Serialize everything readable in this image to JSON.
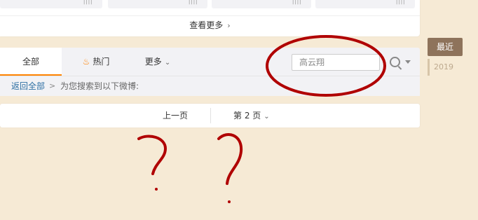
{
  "feed": {
    "see_more_label": "查看更多",
    "stub_glyph": "|",
    "stub_value": "||||"
  },
  "tabs": {
    "all_label": "全部",
    "hot_label": "热门",
    "more_label": "更多"
  },
  "search": {
    "placeholder": "高云翔",
    "value": ""
  },
  "breadcrumb": {
    "back_label": "返回全部",
    "separator": ">",
    "text": "为您搜索到以下微博:"
  },
  "pager": {
    "prev_label": "上一页",
    "page_label": "第 2 页"
  },
  "timeline": {
    "recent_label": "最近",
    "year_label": "2019"
  },
  "icons": {
    "flame": "flame-icon",
    "search": "search-icon",
    "chevron": "chevron-icon"
  },
  "colors": {
    "background": "#f6ead5",
    "accent_orange": "#ff8200",
    "link_blue": "#2d6fa3",
    "timeline_active": "#8e735b",
    "annotation_red": "#b00000"
  }
}
